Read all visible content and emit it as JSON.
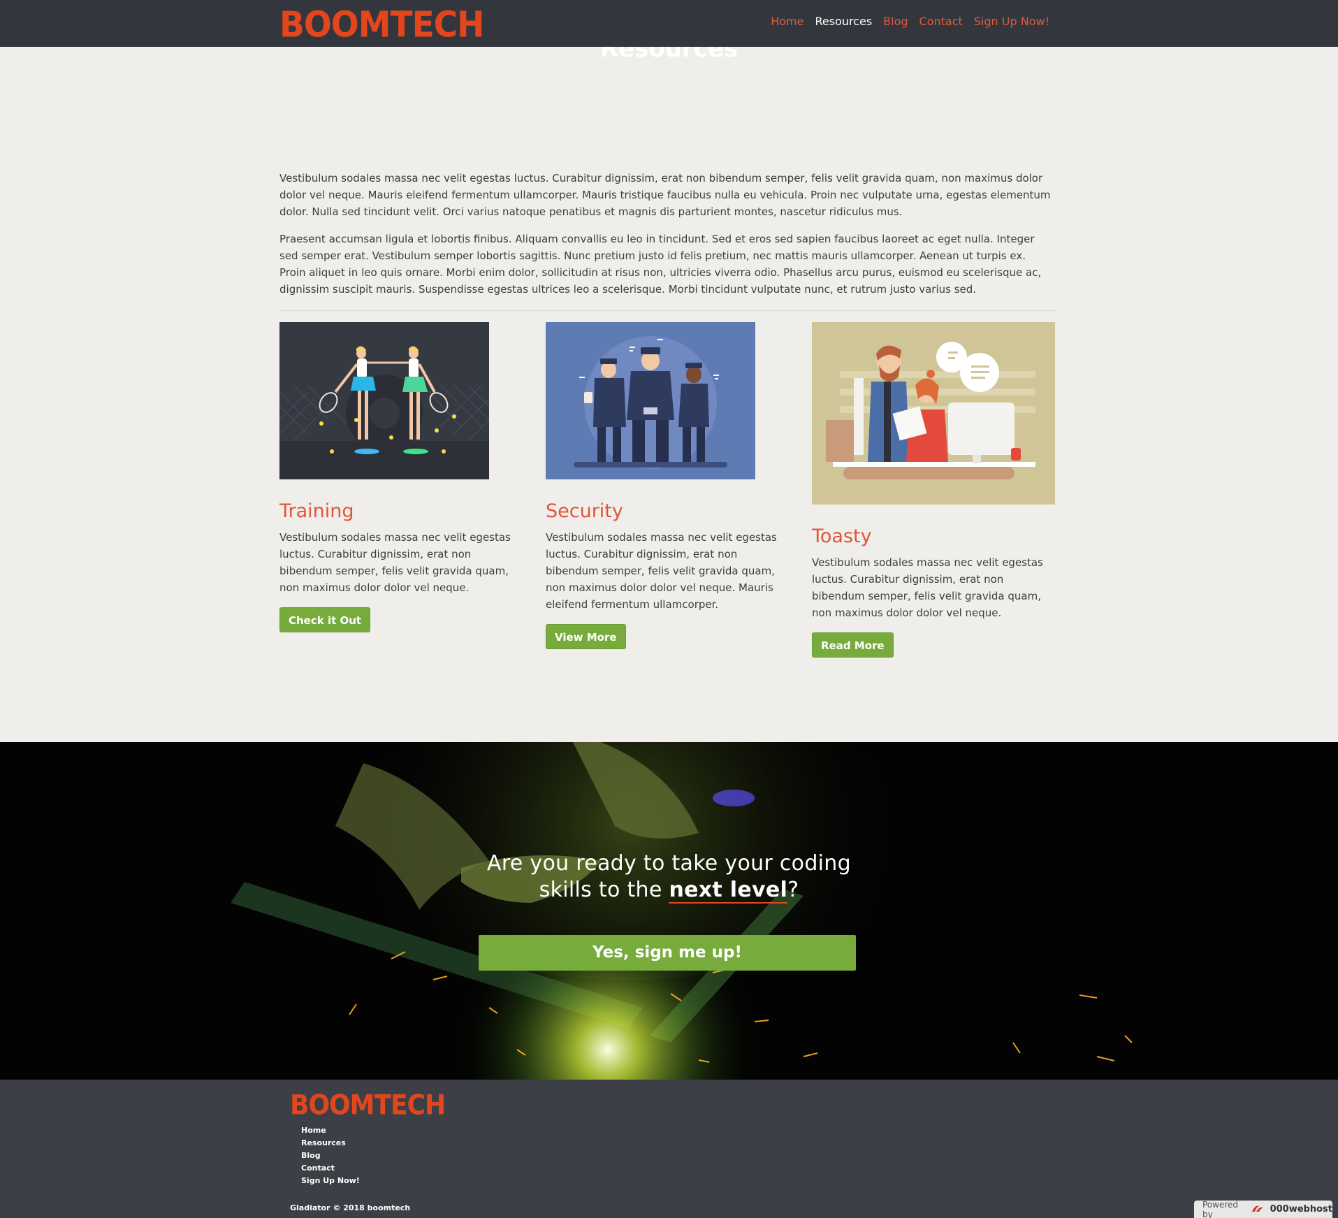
{
  "brand": {
    "logo": "BOOMTECH"
  },
  "nav": {
    "items": [
      {
        "label": "Home",
        "active": false
      },
      {
        "label": "Resources",
        "active": true
      },
      {
        "label": "Blog",
        "active": false
      },
      {
        "label": "Contact",
        "active": false
      },
      {
        "label": "Sign Up Now!",
        "active": false
      }
    ]
  },
  "hero": {
    "title": "Resources"
  },
  "intro": {
    "paragraphs": [
      "Vestibulum sodales massa nec velit egestas luctus. Curabitur dignissim, erat non bibendum semper, felis velit gravida quam, non maximus dolor dolor vel neque. Mauris eleifend fermentum ullamcorper. Mauris tristique faucibus nulla eu vehicula. Proin nec vulputate urna, egestas elementum dolor. Nulla sed tincidunt velit. Orci varius natoque penatibus et magnis dis parturient montes, nascetur ridiculus mus.",
      "Praesent accumsan ligula et lobortis finibus. Aliquam convallis eu leo in tincidunt. Sed et eros sed sapien faucibus laoreet ac eget nulla. Integer sed semper erat. Vestibulum semper lobortis sagittis. Nunc pretium justo id felis pretium, nec mattis mauris ullamcorper. Aenean ut turpis ex. Proin aliquet in leo quis ornare. Morbi enim dolor, sollicitudin at risus non, ultricies viverra odio. Phasellus arcu purus, euismod eu scelerisque ac, dignissim suscipit mauris. Suspendisse egestas ultrices leo a scelerisque. Morbi tincidunt vulputate nunc, et rutrum justo varius sed."
    ]
  },
  "cards": [
    {
      "title": "Training",
      "text": "Vestibulum sodales massa nec velit egestas luctus. Curabitur dignissim, erat non bibendum semper, felis velit gravida quam, non maximus dolor dolor vel neque.",
      "button": "Check it Out"
    },
    {
      "title": "Security",
      "text": "Vestibulum sodales massa nec velit egestas luctus. Curabitur dignissim, erat non bibendum semper, felis velit gravida quam, non maximus dolor dolor vel neque. Mauris eleifend fermentum ullamcorper.",
      "button": "View More"
    },
    {
      "title": "Toasty",
      "text": "Vestibulum sodales massa nec velit egestas luctus. Curabitur dignissim, erat non bibendum semper, felis velit gravida quam, non maximus dolor dolor vel neque.",
      "button": "Read More"
    }
  ],
  "cta": {
    "line1": "Are you ready to take your coding",
    "line2_pre": "skills to the ",
    "line2_highlight": "next level",
    "line2_post": "?",
    "button": "Yes, sign me up!"
  },
  "footer": {
    "logo": "BOOMTECH",
    "links": [
      "Home",
      "Resources",
      "Blog",
      "Contact",
      "Sign Up Now!"
    ],
    "copyright": "Gladiator © 2018 boomtech"
  },
  "badge": {
    "prefix": "Powered by",
    "brand": "000webhost"
  },
  "colors": {
    "accent": "#e3461c",
    "nav_bg": "#33373d",
    "button_green": "#77ab3b",
    "page_bg": "#efeeea"
  }
}
